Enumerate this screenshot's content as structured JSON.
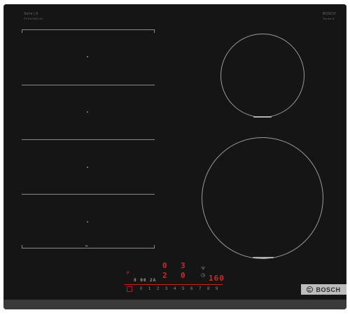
{
  "appliance": {
    "series_label_left": "Serie | 8",
    "series_label_left_sub": "PXX675DC1E",
    "series_label_right": "BOSCH",
    "series_label_right_sub": "Series 8"
  },
  "zones": {
    "flex_zone_dots": [
      "flex-dot-1",
      "flex-dot-2",
      "flex-dot-3",
      "flex-dot-4"
    ],
    "rear_right_label": "",
    "front_right_label": ""
  },
  "controls": {
    "display_left_top": "0",
    "display_left_bottom": "2",
    "display_mid_top": "3",
    "display_mid_bottom": "0",
    "display_right": "160",
    "power_label": "P",
    "scale": [
      "0",
      "1",
      "2",
      "3",
      "4",
      "5",
      "6",
      "7",
      "8",
      "9"
    ],
    "small_indicator_text": "8 00 2A",
    "timer_icon": "timer-icon",
    "wifi_icon": "wifi-icon"
  },
  "brand": {
    "name": "BOSCH"
  },
  "colors": {
    "glass": "#151515",
    "display_red": "#d6262b",
    "marking_grey": "#8a8a8a",
    "brand_plate": "#bdbdbd"
  }
}
